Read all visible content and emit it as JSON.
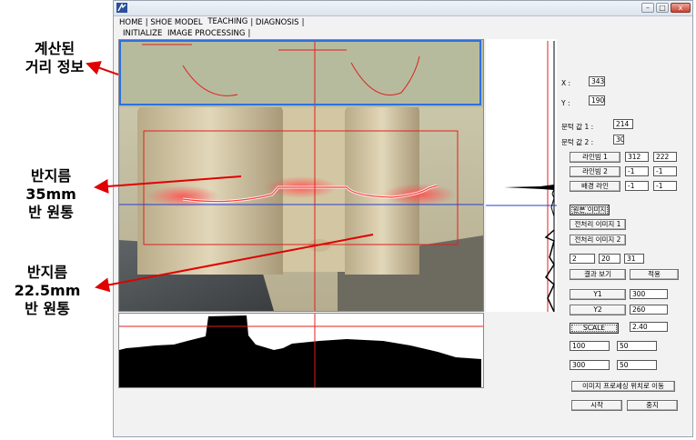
{
  "annotations": {
    "distance_info": [
      "계산된",
      "거리 정보"
    ],
    "radius_35": [
      "반지름",
      "35mm",
      "반 원통"
    ],
    "radius_22": [
      "반지름",
      "22.5mm",
      "반 원통"
    ]
  },
  "window": {
    "controls": {
      "minimize": "–",
      "maximize": "□",
      "close": "x"
    },
    "tabs_row1": [
      "HOME",
      "SHOE MODEL",
      "TEACHING",
      "DIAGNOSIS"
    ],
    "tabs_row2": [
      "INITIALIZE",
      "IMAGE PROCESSING"
    ]
  },
  "coords": {
    "x_label": "X :",
    "x_value": "343",
    "y_label": "Y :",
    "y_value": "190"
  },
  "threshold": {
    "t1_label": "문턱 값 1 :",
    "t1_value": "214",
    "t2_label": "문턱 값 2 :",
    "t2_value": "30"
  },
  "lines": {
    "line1_label": "라인빔 1",
    "line1_a": "312",
    "line1_b": "222",
    "line2_label": "라인빔 2",
    "line2_a": "-1",
    "line2_b": "-1",
    "bg_label": "배경 라인",
    "bg_a": "-1",
    "bg_b": "-1"
  },
  "image_buttons": {
    "original": "원본 이미지",
    "pre1": "전처리 이미지 1",
    "pre2": "전처리 이미지 2"
  },
  "params": {
    "p1": "2",
    "p2": "20",
    "p3": "31"
  },
  "result_view": "결과 보기",
  "apply": "적용",
  "y1": {
    "label": "Y1",
    "value": "300"
  },
  "y2": {
    "label": "Y2",
    "value": "260"
  },
  "scale": {
    "label": "SCALE",
    "value": "2.40"
  },
  "ranges": {
    "r1a": "100",
    "r1b": "50",
    "r2a": "300",
    "r2b": "50"
  },
  "move_button": "이미지 프로세싱 위치로 이동",
  "start": "시작",
  "stop": "중지",
  "colors": {
    "annotation_arrow": "#e00000",
    "highlight_box": "#2f6fe0",
    "laser_red": "#ff2020",
    "camera_bg": "#c9c2a6"
  }
}
